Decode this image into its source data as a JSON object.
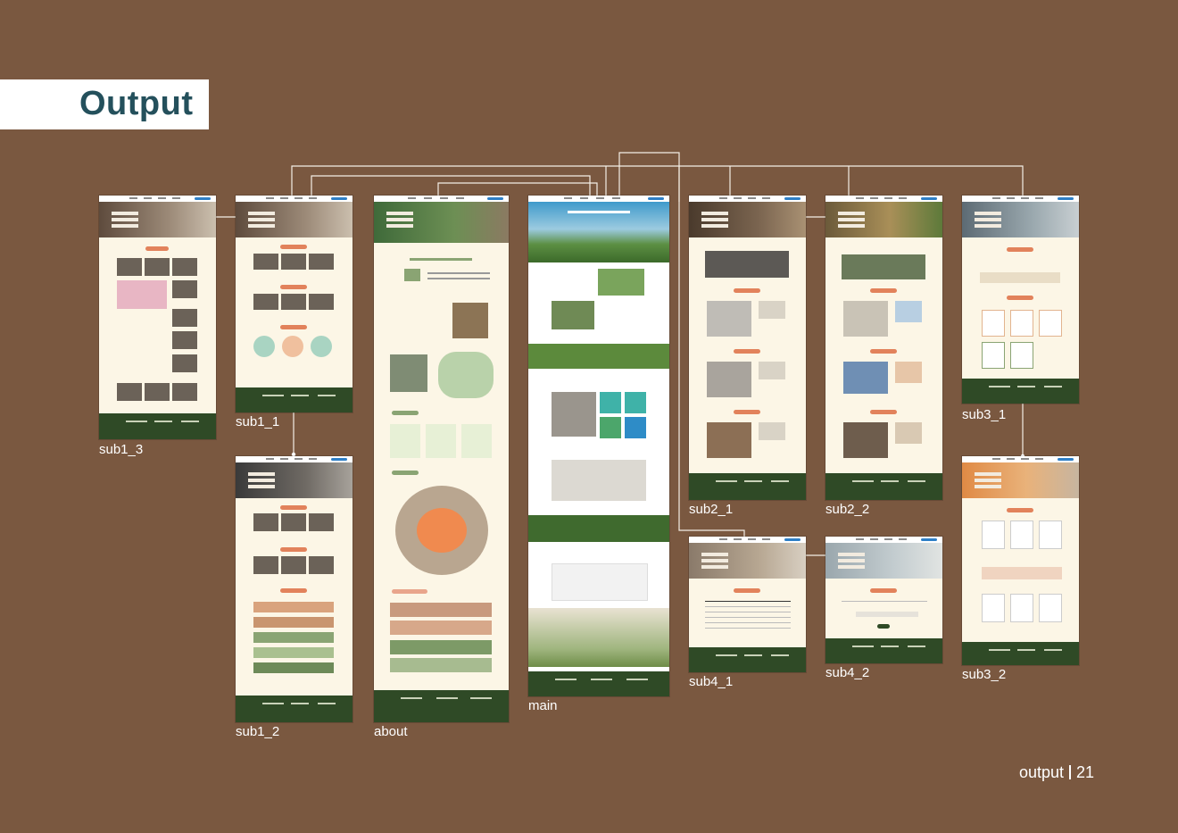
{
  "page": {
    "title": "Output",
    "footer_label": "output",
    "page_number": "21"
  },
  "thumbnails": {
    "sub1_3": "sub1_3",
    "sub1_1": "sub1_1",
    "sub1_2": "sub1_2",
    "about": "about",
    "main": "main",
    "sub2_1": "sub2_1",
    "sub2_2": "sub2_2",
    "sub3_1": "sub3_1",
    "sub3_2": "sub3_2",
    "sub4_1": "sub4_1",
    "sub4_2": "sub4_2"
  },
  "colors": {
    "background": "#7a5840",
    "title": "#24505c",
    "cream": "#fcf6e6",
    "footer_green": "#2f4a26",
    "accent": "#e2825b"
  }
}
